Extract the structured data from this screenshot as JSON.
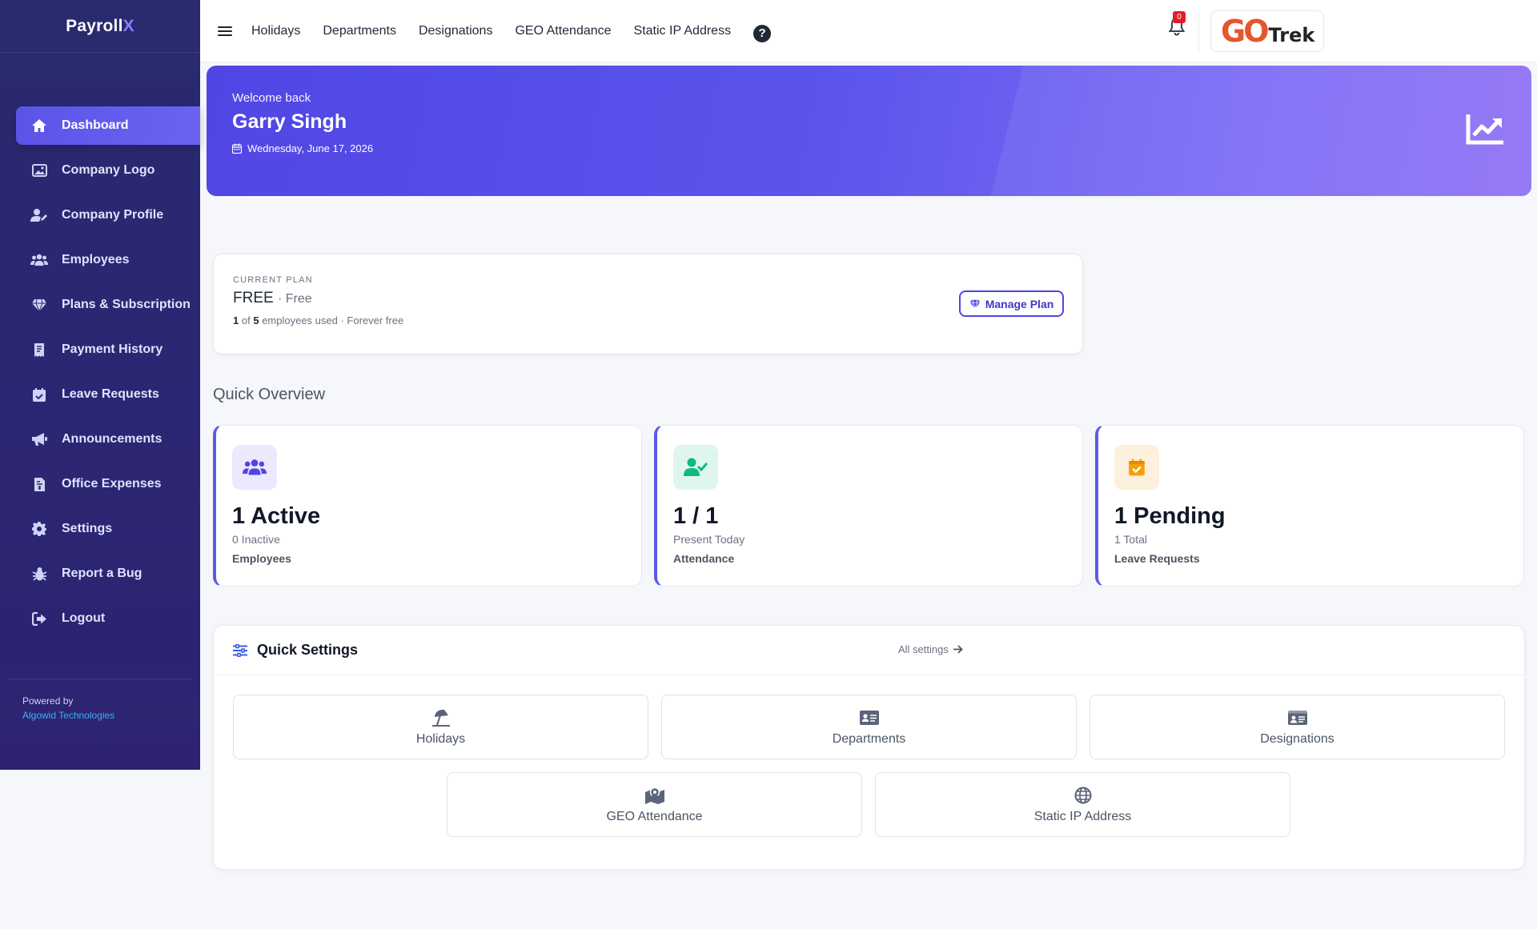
{
  "brand": {
    "name_a": "Payroll",
    "name_b": "X"
  },
  "sidebar": {
    "items": [
      {
        "label": "Dashboard",
        "icon": "home-icon",
        "active": true
      },
      {
        "label": "Company Logo",
        "icon": "image-icon"
      },
      {
        "label": "Company Profile",
        "icon": "user-edit-icon"
      },
      {
        "label": "Employees",
        "icon": "users-icon"
      },
      {
        "label": "Plans & Subscription",
        "icon": "gem-icon"
      },
      {
        "label": "Payment History",
        "icon": "receipt-icon"
      },
      {
        "label": "Leave Requests",
        "icon": "calendar-check-icon"
      },
      {
        "label": "Announcements",
        "icon": "megaphone-icon"
      },
      {
        "label": "Office Expenses",
        "icon": "invoice-icon"
      },
      {
        "label": "Settings",
        "icon": "gear-icon"
      },
      {
        "label": "Report a Bug",
        "icon": "bug-icon"
      },
      {
        "label": "Logout",
        "icon": "logout-icon"
      }
    ],
    "footer": {
      "powered_by": "Powered by",
      "company": "Algowid Technologies"
    }
  },
  "topbar": {
    "links": [
      "Holidays",
      "Departments",
      "Designations",
      "GEO Attendance",
      "Static IP Address"
    ],
    "help": "?",
    "notification_count": "0",
    "logo": {
      "part1": "GO",
      "part2": "Trek"
    }
  },
  "hero": {
    "welcome": "Welcome back",
    "name": "Garry Singh",
    "date": "Wednesday, June 17, 2026"
  },
  "plan": {
    "label": "CURRENT PLAN",
    "name": "FREE",
    "tier": "· Free",
    "used": "1",
    "of_text": "of",
    "total": "5",
    "usage_suffix": "employees used · Forever free",
    "button": "Manage Plan"
  },
  "overview": {
    "title": "Quick Overview",
    "cards": [
      {
        "value": "1 Active",
        "sub": "0 Inactive",
        "caption": "Employees",
        "icon": "users-icon",
        "icon_color": "#4f46e5",
        "icon_bg": "#ece9fd"
      },
      {
        "value": "1 / 1",
        "sub": "Present Today",
        "caption": "Attendance",
        "icon": "user-check-icon",
        "icon_color": "#10b981",
        "icon_bg": "#dff6ee"
      },
      {
        "value": "1 Pending",
        "sub": "1 Total",
        "caption": "Leave Requests",
        "icon": "calendar-check-icon",
        "icon_color": "#f59e0b",
        "icon_bg": "#fdf0dc"
      }
    ]
  },
  "quick_settings": {
    "title": "Quick Settings",
    "all_link": "All settings",
    "tiles": [
      {
        "label": "Holidays",
        "icon": "umbrella-beach-icon"
      },
      {
        "label": "Departments",
        "icon": "id-card-icon"
      },
      {
        "label": "Designations",
        "icon": "id-card-icon"
      },
      {
        "label": "GEO Attendance",
        "icon": "map-location-icon"
      },
      {
        "label": "Static IP Address",
        "icon": "globe-icon"
      }
    ]
  },
  "colors": {
    "sidebar": "#2b2773",
    "accent": "#4f46e5",
    "hero_start": "#5046e4",
    "hero_end": "#8f6ff6"
  }
}
